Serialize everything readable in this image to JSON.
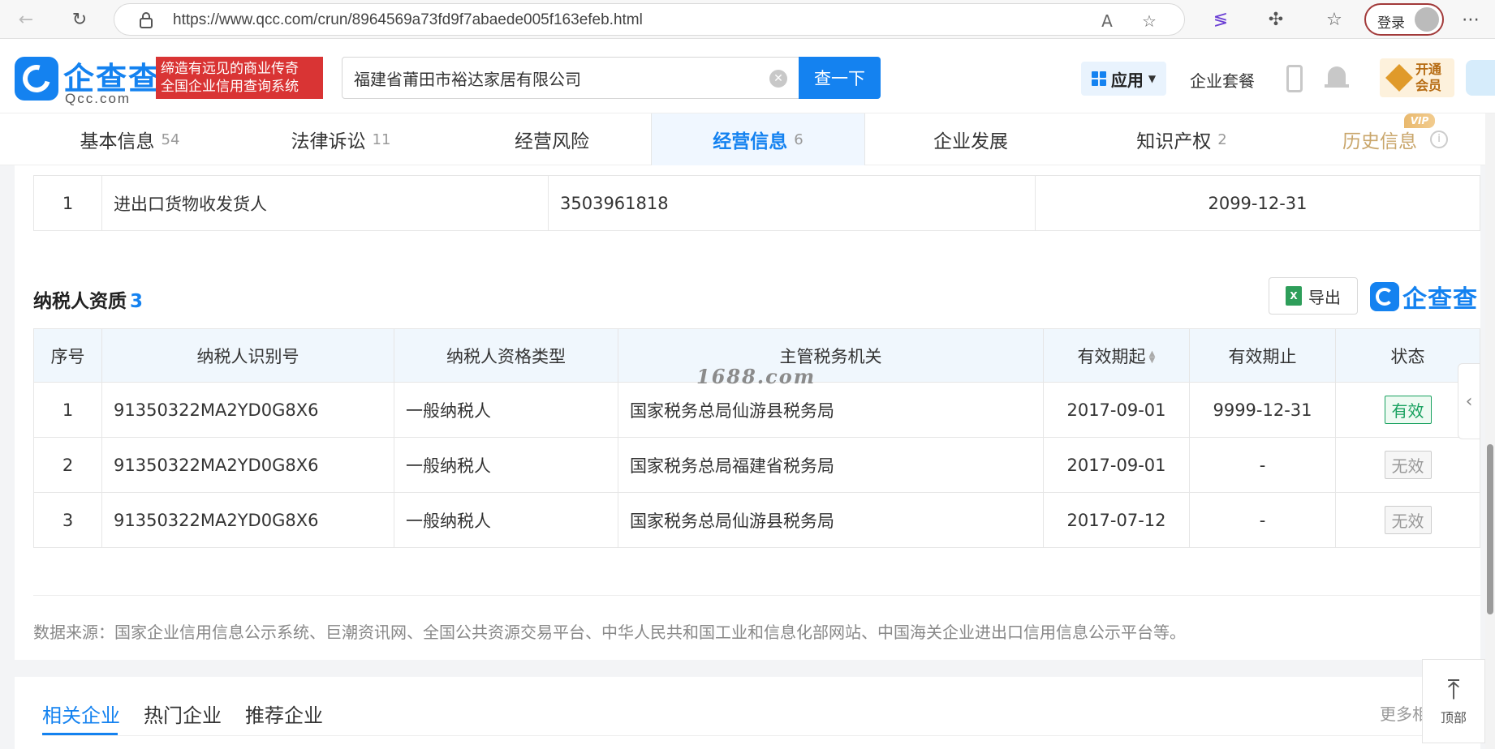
{
  "browser": {
    "url": "https://www.qcc.com/crun/8964569a73fd9f7abaede005f163efeb.html",
    "login_label": "登录"
  },
  "header": {
    "logo_text": "企查查",
    "logo_sub": "Qcc.com",
    "slogan_line1": "缔造有远见的商业传奇",
    "slogan_line2": "全国企业信用查询系统",
    "search_value": "福建省莆田市裕达家居有限公司",
    "search_button": "查一下",
    "app_menu": "应用",
    "suite_link": "企业套餐",
    "vip_line1": "开通",
    "vip_line2": "会员"
  },
  "tabs": [
    {
      "label": "基本信息",
      "count": "54"
    },
    {
      "label": "法律诉讼",
      "count": "11"
    },
    {
      "label": "经营风险",
      "count": ""
    },
    {
      "label": "经营信息",
      "count": "6"
    },
    {
      "label": "企业发展",
      "count": ""
    },
    {
      "label": "知识产权",
      "count": "2"
    },
    {
      "label": "历史信息",
      "count": ""
    }
  ],
  "vip_tag": "VIP",
  "prev_row": {
    "index": "1",
    "type": "进出口货物收发货人",
    "code": "3503961818",
    "date": "2099-12-31"
  },
  "taxpayer": {
    "title": "纳税人资质",
    "count": "3",
    "export_label": "导出",
    "brand": "企查查",
    "columns": [
      "序号",
      "纳税人识别号",
      "纳税人资格类型",
      "主管税务机关",
      "有效期起",
      "有效期止",
      "状态"
    ],
    "rows": [
      {
        "index": "1",
        "id": "91350322MA2YD0G8X6",
        "type": "一般纳税人",
        "authority": "国家税务总局仙游县税务局",
        "start": "2017-09-01",
        "end": "9999-12-31",
        "status": "有效"
      },
      {
        "index": "2",
        "id": "91350322MA2YD0G8X6",
        "type": "一般纳税人",
        "authority": "国家税务总局福建省税务局",
        "start": "2017-09-01",
        "end": "-",
        "status": "无效"
      },
      {
        "index": "3",
        "id": "91350322MA2YD0G8X6",
        "type": "一般纳税人",
        "authority": "国家税务总局仙游县税务局",
        "start": "2017-07-12",
        "end": "-",
        "status": "无效"
      }
    ]
  },
  "watermark": "1688.com",
  "source_note": "数据来源：国家企业信用信息公示系统、巨潮资讯网、全国公共资源交易平台、中华人民共和国工业和信息化部网站、中国海关企业进出口信用信息公示平台等。",
  "bottom_tabs": [
    "相关企业",
    "热门企业",
    "推荐企业"
  ],
  "more_link": "更多相",
  "totop_label": "顶部",
  "colors": {
    "brand": "#1482f0",
    "slogan_bg": "#d93434",
    "valid": "#19a15f"
  }
}
